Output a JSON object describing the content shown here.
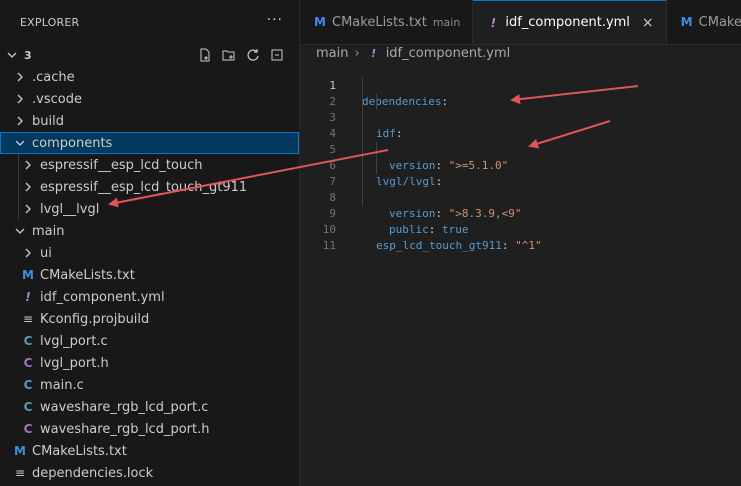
{
  "explorer": {
    "title": "EXPLORER",
    "more": "···",
    "root": "3"
  },
  "tree": [
    {
      "label": ".cache",
      "type": "folder",
      "expanded": false
    },
    {
      "label": ".vscode",
      "type": "folder",
      "expanded": false
    },
    {
      "label": "build",
      "type": "folder",
      "expanded": false
    },
    {
      "label": "components",
      "type": "folder",
      "expanded": true
    },
    {
      "label": "espressif__esp_lcd_touch",
      "type": "folder",
      "expanded": false
    },
    {
      "label": "espressif__esp_lcd_touch_gt911",
      "type": "folder",
      "expanded": false
    },
    {
      "label": "lvgl__lvgl",
      "type": "folder",
      "expanded": false
    },
    {
      "label": "main",
      "type": "folder",
      "expanded": true
    },
    {
      "label": "ui",
      "type": "folder",
      "expanded": false
    },
    {
      "label": "CMakeLists.txt",
      "type": "file",
      "icon": "M"
    },
    {
      "label": "idf_component.yml",
      "type": "file",
      "icon": "!"
    },
    {
      "label": "Kconfig.projbuild",
      "type": "file",
      "icon": "≡"
    },
    {
      "label": "lvgl_port.c",
      "type": "file",
      "icon": "C"
    },
    {
      "label": "lvgl_port.h",
      "type": "file",
      "icon": "C"
    },
    {
      "label": "main.c",
      "type": "file",
      "icon": "C"
    },
    {
      "label": "waveshare_rgb_lcd_port.c",
      "type": "file",
      "icon": "C"
    },
    {
      "label": "waveshare_rgb_lcd_port.h",
      "type": "file",
      "icon": "C"
    },
    {
      "label": "CMakeLists.txt",
      "type": "file",
      "icon": "M"
    },
    {
      "label": "dependencies.lock",
      "type": "file",
      "icon": "≡"
    }
  ],
  "tabs": [
    {
      "icon": "M",
      "label": "CMakeLists.txt",
      "desc": "main"
    },
    {
      "icon": "!",
      "label": "idf_component.yml",
      "close": "×"
    },
    {
      "icon": "M",
      "label": "CMakeLists.txt"
    }
  ],
  "breadcrumb": {
    "folder": "main",
    "sep": "›",
    "icon": "!",
    "file": "idf_component.yml"
  },
  "code": {
    "line_numbers": [
      "1",
      "2",
      "3",
      "4",
      "5",
      "6",
      "7",
      "8",
      "9",
      "10",
      "11"
    ],
    "l1_key": "dependencies",
    "colon": ":",
    "l2_key": "idf",
    "l3_key": "version",
    "l3_val": "\">=5.1.0\"",
    "l5_key": "lvgl/lvgl",
    "l6_key": "version",
    "l6_val": "\">8.3.9,<9\"",
    "l7_key": "public",
    "l7_val": "true",
    "l9_key": "esp_lcd_touch_gt911",
    "l9_val": "\"^1\""
  },
  "colors": {
    "accent": "#0078d4",
    "selection": "#04395e",
    "arrow": "#e05555"
  }
}
